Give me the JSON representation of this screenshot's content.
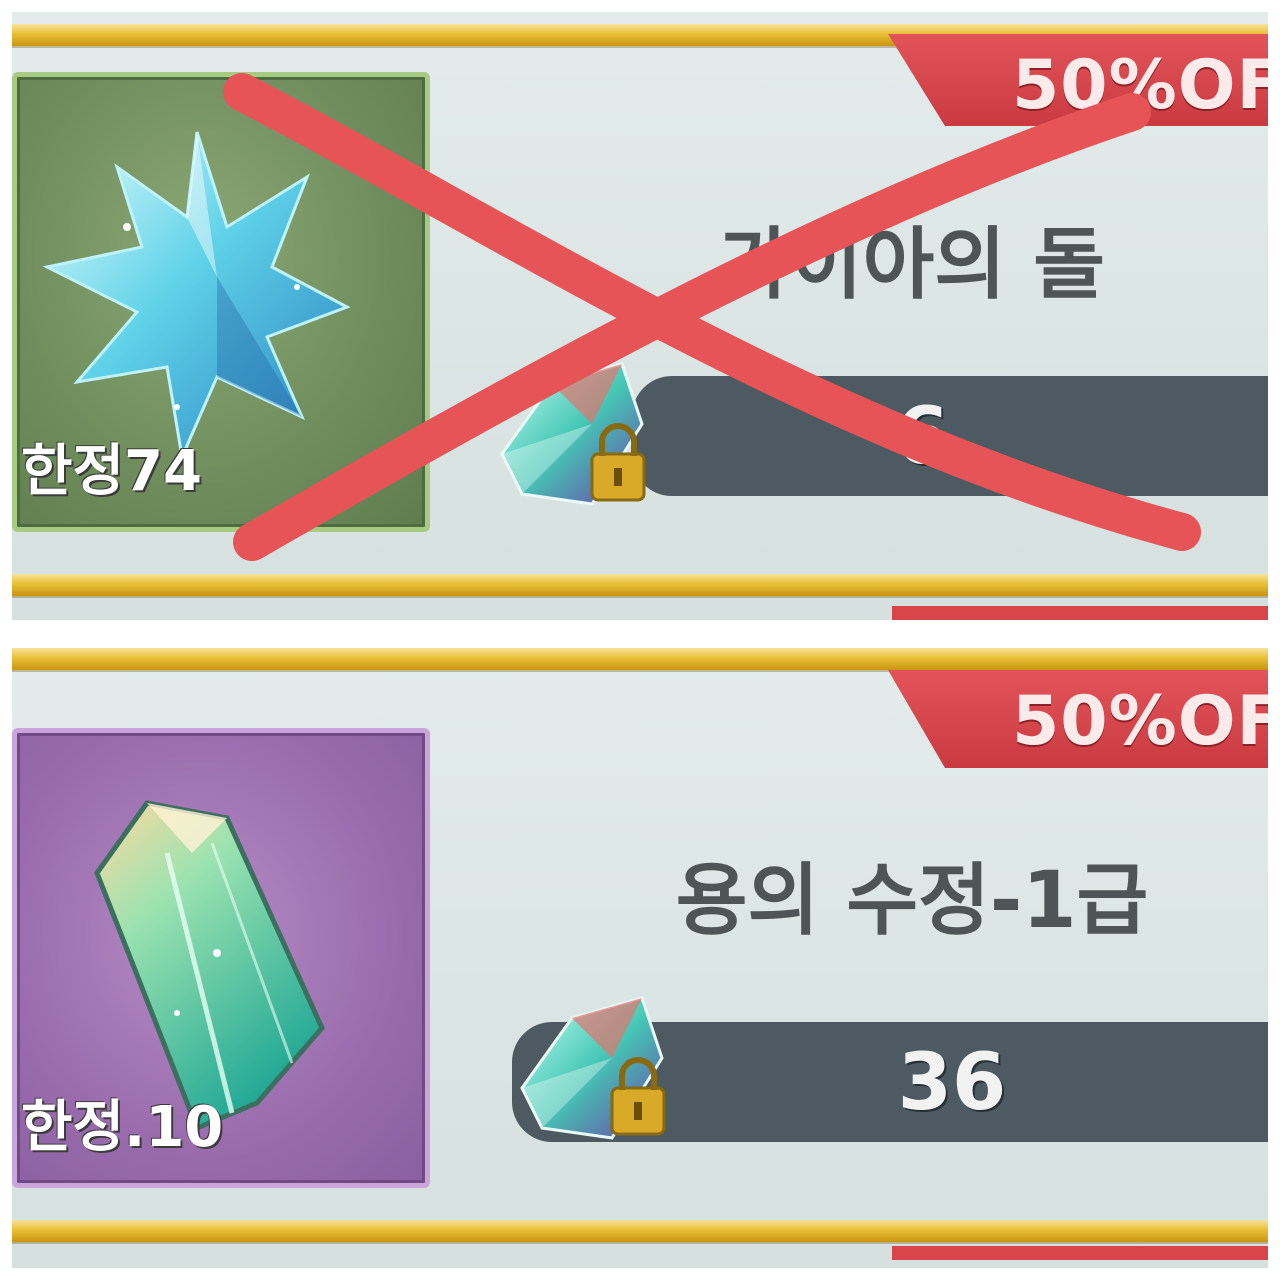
{
  "colors": {
    "gold": "#e9bf36",
    "discount_red": "#d8454a",
    "price_bar": "#4d5a61",
    "cross_red": "#e65457",
    "green_box": "#6f8d5c",
    "purple_box": "#9a6cae"
  },
  "items": [
    {
      "discount": "50%OF",
      "name": "가이아의 돌",
      "limit": "한정74",
      "price": "6",
      "icon": "star-crystal-icon",
      "price_icon": "gem-lock-icon",
      "crossed_out": true
    },
    {
      "discount": "50%OF",
      "name": "용의 수정-1급",
      "limit": "한정.10",
      "price": "36",
      "icon": "crystal-shard-icon",
      "price_icon": "gem-lock-icon",
      "crossed_out": false
    }
  ]
}
